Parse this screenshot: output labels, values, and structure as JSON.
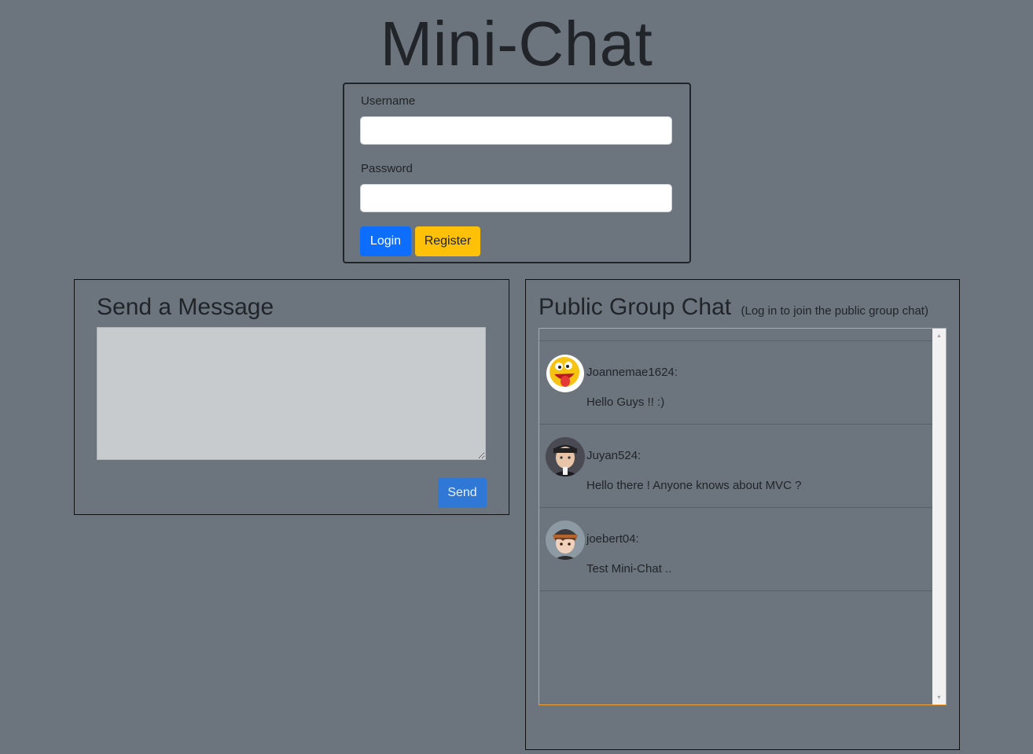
{
  "app": {
    "title": "Mini-Chat"
  },
  "login": {
    "username_label": "Username",
    "username_value": "",
    "password_label": "Password",
    "password_value": "",
    "login_label": "Login",
    "register_label": "Register"
  },
  "send_panel": {
    "heading": "Send a Message",
    "message_value": "",
    "send_label": "Send"
  },
  "chat_panel": {
    "heading": "Public Group Chat",
    "subheading": "(Log in to join the public group chat)",
    "messages": [
      {
        "user": "Joannemae1624:",
        "text": "Hello Guys !! :)",
        "avatar": "laughing-emoji-icon"
      },
      {
        "user": "Juyan524:",
        "text": "Hello there ! Anyone knows about MVC ?",
        "avatar": "anime-boy-avatar"
      },
      {
        "user": "joebert04:",
        "text": "Test Mini-Chat ..",
        "avatar": "anime-boy-cap-avatar"
      }
    ]
  },
  "colors": {
    "background": "#6c757d",
    "login_button": "#0d6efd",
    "register_button": "#ffc107",
    "send_button": "#2f78d6",
    "chat_border": "#f0a030"
  }
}
